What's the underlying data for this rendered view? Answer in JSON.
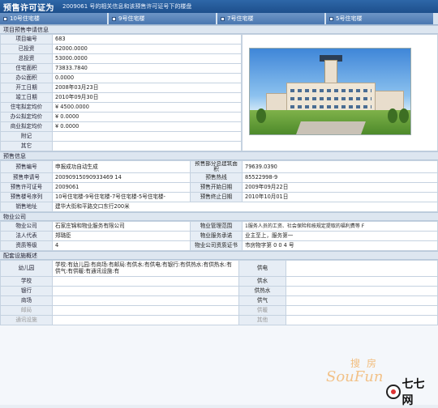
{
  "header": {
    "title": "预售许可证为",
    "subtitle": "2009061 号的相关信息和该预售许可证号下的楼盘"
  },
  "tabs": [
    "10号住宅楼",
    "9号住宅楼",
    "7号住宅楼",
    "5号住宅楼"
  ],
  "project": {
    "section_title": "项目预售申请信息",
    "rows": [
      {
        "label": "项目编号",
        "value": "683"
      },
      {
        "label": "已投资",
        "value": "42000.0000"
      },
      {
        "label": "总投资",
        "value": "53000.0000"
      },
      {
        "label": "住宅面积",
        "value": "73833.7840"
      },
      {
        "label": "办公面积",
        "value": "0.0000"
      },
      {
        "label": "开工日期",
        "value": "2008年03月23日"
      },
      {
        "label": "竣工日期",
        "value": "2010年09月30日"
      },
      {
        "label": "住宅拟定均价",
        "value": "¥ 4500.0000"
      },
      {
        "label": "办公拟定均价",
        "value": "¥ 0.0000"
      },
      {
        "label": "商业拟定均价",
        "value": "¥ 0.0000"
      },
      {
        "label": "附记",
        "value": ""
      },
      {
        "label": "其它",
        "value": ""
      }
    ]
  },
  "sale": {
    "section_title": "预售信息",
    "rows": [
      {
        "l1": "预售编号",
        "v1": "申报成功自动生成",
        "l2": "预售部分总建筑面积",
        "v2": "79639.0390"
      },
      {
        "l1": "预售申请号",
        "v1": "20090915090933469 14",
        "l2": "预售热线",
        "v2": "85522998-9"
      },
      {
        "l1": "预售许可证号",
        "v1": "2009061",
        "l2": "预售开始日期",
        "v2": "2009年09月22日"
      },
      {
        "l1": "预售楼号序列",
        "v1": "10号住宅楼-9号住宅楼-7号住宅楼-5号住宅楼-",
        "l2": "预售终止日期",
        "v2": "2010年10月01日"
      },
      {
        "l1": "销售地址",
        "v1": "建华大街和平路交口东行200米",
        "l2": "",
        "v2": ""
      }
    ]
  },
  "property": {
    "section_title": "物业公司",
    "rows": [
      {
        "l1": "物业公司",
        "v1": "石家庄锦和物业服务有限公司",
        "l2": "物业管理范围",
        "v2": "1服务人员的工资、社会保险和按规定提取的福利费等 F"
      },
      {
        "l1": "法人代表",
        "v1": "郑璐臣",
        "l2": "物业服务承诺",
        "v2": "业主至上，服务第一"
      },
      {
        "l1": "资质等级",
        "v1": "4",
        "l2": "物业公司资质证书",
        "v2": "市房物字第 0 0 4 号"
      }
    ]
  },
  "facilities": {
    "section_title": "配套设施概述",
    "rows": [
      {
        "l1": "幼儿园",
        "v1": "学校:有幼儿园:有商场:有邮局:有供水:有供电:有银行:有供热水:有供热水:有供气:有供暖:有通讯设施:有",
        "l2": "供电",
        "v2": ""
      },
      {
        "l1": "学校",
        "v1": "",
        "l2": "供水",
        "v2": ""
      },
      {
        "l1": "银行",
        "v1": "",
        "l2": "供热水",
        "v2": ""
      },
      {
        "l1": "商场",
        "v1": "",
        "l2": "供气",
        "v2": ""
      },
      {
        "l1": "邮局",
        "v1": "",
        "l2": "供暖",
        "v2": ""
      },
      {
        "l1": "通讯设施",
        "v1": "",
        "l2": "其他",
        "v2": ""
      }
    ]
  },
  "watermark": {
    "site_cn": "搜房",
    "site_en": "SouFun",
    "brand": "七七网"
  }
}
